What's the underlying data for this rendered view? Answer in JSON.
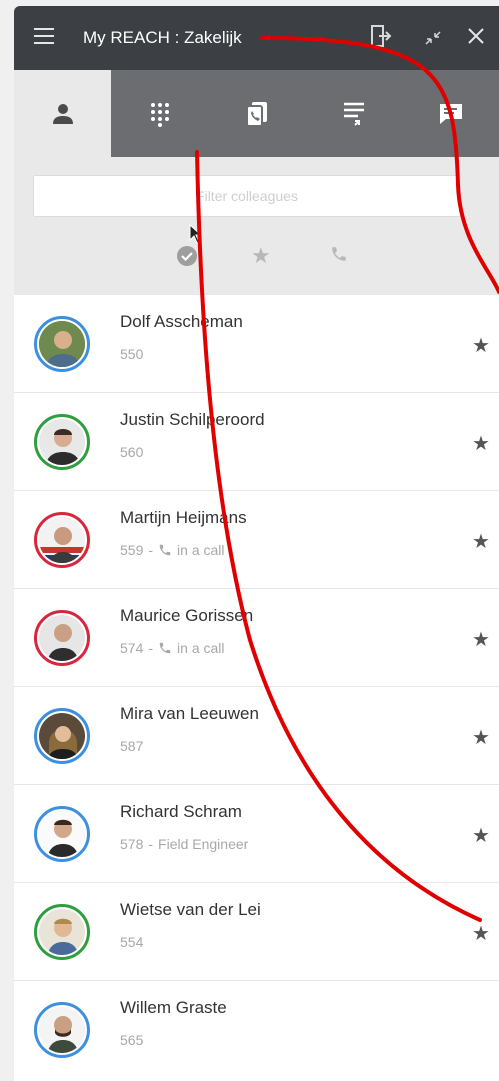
{
  "window": {
    "title": "My REACH : Zakelijk",
    "icons": [
      "hamburger-icon",
      "exit-icon",
      "minimize-icon",
      "close-icon"
    ]
  },
  "tabs": [
    {
      "name": "colleagues",
      "icon": "person-icon",
      "active": true
    },
    {
      "name": "dialpad",
      "icon": "dialpad-icon",
      "active": false
    },
    {
      "name": "call-history",
      "icon": "call-history-icon",
      "active": false
    },
    {
      "name": "queues",
      "icon": "queue-icon",
      "active": false
    },
    {
      "name": "chat",
      "icon": "chat-icon",
      "active": false
    }
  ],
  "filter": {
    "placeholder": "Filter colleagues",
    "filters": [
      "available-check-icon",
      "favorite-star-icon",
      "phone-icon"
    ]
  },
  "colleagues": [
    {
      "name": "Dolf Asscheman",
      "ext": "550",
      "extra": "",
      "status": "",
      "ring": "#3d8fe0"
    },
    {
      "name": "Justin Schilperoord",
      "ext": "560",
      "extra": "",
      "status": "",
      "ring": "#2e9e3e"
    },
    {
      "name": "Martijn Heijmans",
      "ext": "559",
      "extra": "",
      "status": "in a call",
      "ring": "#d9263c"
    },
    {
      "name": "Maurice Gorissen",
      "ext": "574",
      "extra": "",
      "status": "in a call",
      "ring": "#d9263c"
    },
    {
      "name": "Mira van Leeuwen",
      "ext": "587",
      "extra": "",
      "status": "",
      "ring": "#3d8fe0"
    },
    {
      "name": "Richard Schram",
      "ext": "578",
      "extra": "Field Engineer",
      "status": "",
      "ring": "#3d8fe0"
    },
    {
      "name": "Wietse van der Lei",
      "ext": "554",
      "extra": "",
      "status": "",
      "ring": "#2e9e3e"
    },
    {
      "name": "Willem Graste",
      "ext": "565",
      "extra": "",
      "status": "",
      "ring": "#3d8fe0"
    }
  ],
  "separator": "-",
  "colors": {
    "titlebar": "#3c3f43",
    "tabbar": "#6b6d70",
    "annotation": "#e00000"
  }
}
